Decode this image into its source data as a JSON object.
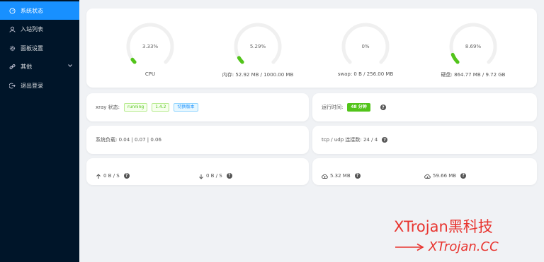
{
  "sidebar": {
    "items": [
      {
        "label": "系统状态",
        "icon": "dashboard-icon"
      },
      {
        "label": "入站列表",
        "icon": "user-icon"
      },
      {
        "label": "面板设置",
        "icon": "gear-icon"
      },
      {
        "label": "其他",
        "icon": "link-icon"
      },
      {
        "label": "退出登录",
        "icon": "logout-icon"
      }
    ]
  },
  "gauges": [
    {
      "percent": "3.33%",
      "value": 3.33,
      "label": "CPU"
    },
    {
      "percent": "5.29%",
      "value": 5.29,
      "label": "内存: 52.92 MB / 1000.00 MB"
    },
    {
      "percent": "0%",
      "value": 0,
      "label": "swap: 0 B / 256.00 MB"
    },
    {
      "percent": "8.69%",
      "value": 8.69,
      "label": "硬盘: 864.77 MB / 9.72 GB"
    }
  ],
  "xray": {
    "label": "xray 状态:",
    "status": "running",
    "version": "1.4.2",
    "switch": "切换版本"
  },
  "uptime": {
    "label": "运行时间:",
    "value": "48 分钟"
  },
  "load": {
    "text": "系统负载: 0.04 | 0.07 | 0.06"
  },
  "connections": {
    "text": "tcp / udp 连接数: 24 / 4"
  },
  "speed": {
    "up": "0 B / S",
    "down": "0 B / S"
  },
  "traffic": {
    "upload": "5.32 MB",
    "download": "59.66 MB"
  },
  "watermark": {
    "title": "XTrojan黑科技",
    "url": "XTrojan.CC"
  },
  "colors": {
    "sidebar": "#001529",
    "active": "#1890ff",
    "gauge": "#52c41a",
    "track": "#f0f0f0"
  }
}
